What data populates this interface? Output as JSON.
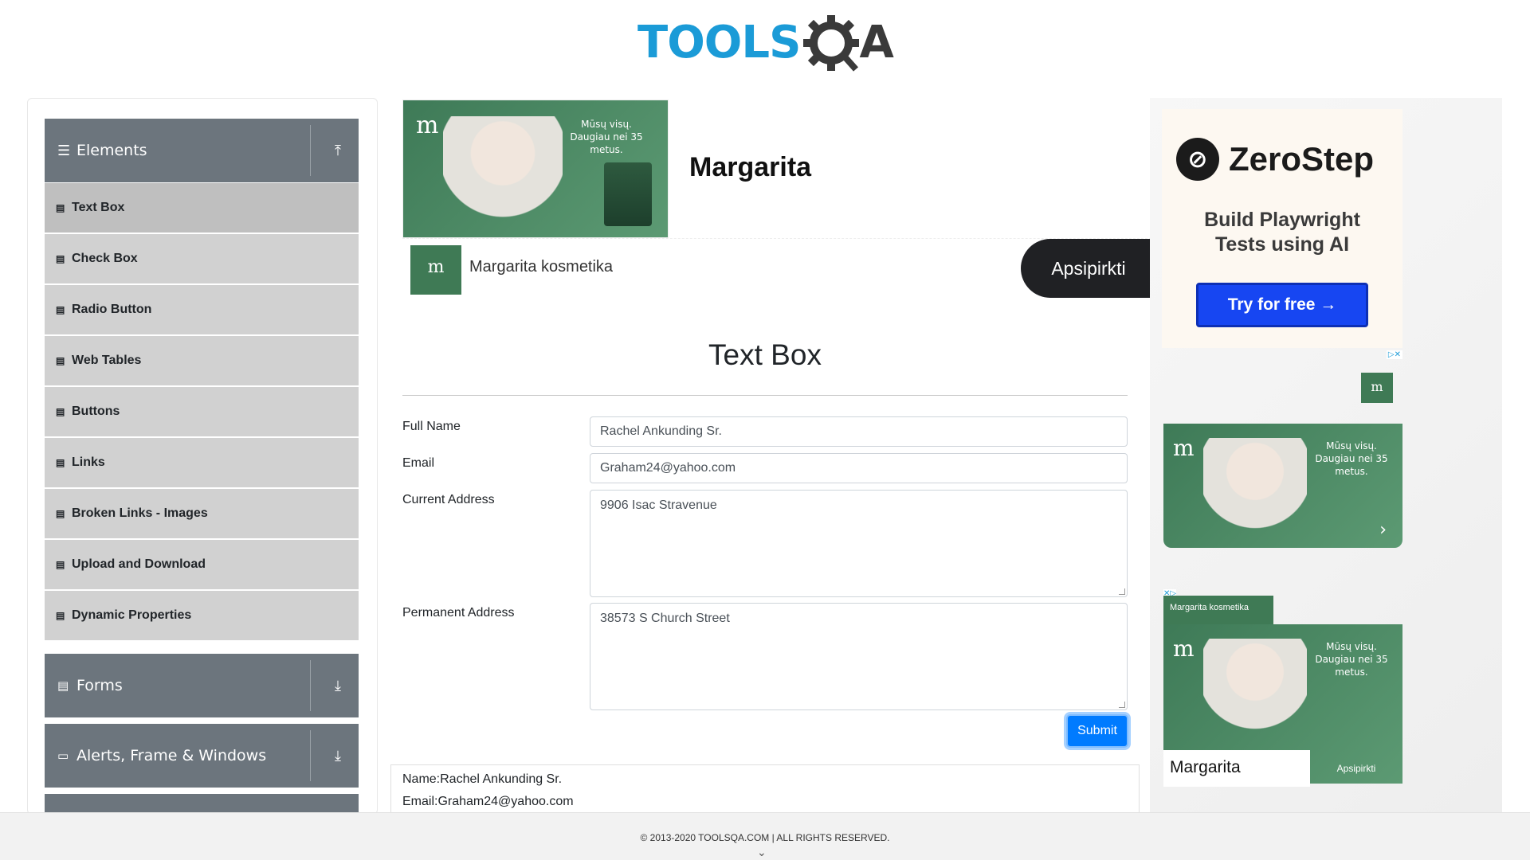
{
  "header": {
    "logo_tools": "TOOLS",
    "logo_qa": "QA"
  },
  "sidebar": {
    "groups": [
      {
        "label": "Elements",
        "icon": "hamburger-icon",
        "arrow": "upload-icon"
      },
      {
        "label": "Forms",
        "icon": "document-icon",
        "arrow": "download-icon"
      },
      {
        "label": "Alerts, Frame & Windows",
        "icon": "window-icon",
        "arrow": "download-icon"
      }
    ],
    "items": [
      {
        "label": "Text Box",
        "active": true
      },
      {
        "label": "Check Box"
      },
      {
        "label": "Radio Button"
      },
      {
        "label": "Web Tables"
      },
      {
        "label": "Buttons"
      },
      {
        "label": "Links"
      },
      {
        "label": "Broken Links - Images"
      },
      {
        "label": "Upload and Download"
      },
      {
        "label": "Dynamic Properties"
      }
    ]
  },
  "top_ad": {
    "banner_text": "Mūsų visų. Daugiau nei 35 metus.",
    "brand": "Margarita",
    "advertiser": "Margarita kosmetika",
    "cta": "Apsipirkti"
  },
  "form": {
    "title": "Text Box",
    "full_name_label": "Full Name",
    "full_name_value": "Rachel Ankunding Sr.",
    "email_label": "Email",
    "email_value": "Graham24@yahoo.com",
    "current_address_label": "Current Address",
    "current_address_value": "9906 Isac Stravenue",
    "permanent_address_label": "Permanent Address",
    "permanent_address_value": "38573 S Church Street",
    "submit_label": "Submit"
  },
  "output": {
    "name_line": "Name:Rachel Ankunding Sr.",
    "email_line": "Email:Graham24@yahoo.com"
  },
  "right_ads": {
    "zerostep": {
      "name": "ZeroStep",
      "tagline": "Build Playwright Tests using AI",
      "cta": "Try for free →"
    },
    "ad2": {
      "banner_text": "Mūsų visų. Daugiau nei 35 metus."
    },
    "ad3": {
      "tab_text": "Margarita kosmetika",
      "banner_text": "Mūsų visų. Daugiau nei 35 metus.",
      "brand": "Margarita",
      "cta": "Apsipirkti"
    }
  },
  "footer": {
    "text": "© 2013-2020 TOOLSQA.COM | ALL RIGHTS RESERVED."
  },
  "colors": {
    "accent": "#007bff",
    "sidebar_header": "#6c757d",
    "sidebar_item": "#d1d1d1",
    "logo_blue": "#1b9bd7",
    "ad_green": "#3f7a55"
  }
}
